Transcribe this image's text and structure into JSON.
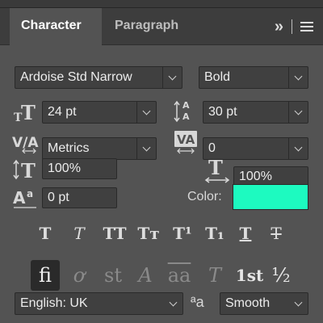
{
  "tabs": [
    {
      "label": "Character"
    },
    {
      "label": "Paragraph"
    }
  ],
  "header_actions": {
    "expand_glyph": "»",
    "menu_icon": "hamburger-menu-icon"
  },
  "font": {
    "family": "Ardoise Std Narrow",
    "style": "Bold"
  },
  "size": {
    "value": "24 pt"
  },
  "leading": {
    "value": "30 pt"
  },
  "kerning": {
    "value": "Metrics"
  },
  "tracking": {
    "value": "0"
  },
  "vertical_scale": {
    "value": "100%"
  },
  "horizontal_scale": {
    "value": "100%"
  },
  "baseline_shift": {
    "value": "0 pt"
  },
  "color": {
    "label": "Color:",
    "swatch": "#1dfac0"
  },
  "style_buttons": [
    {
      "glyph": "T",
      "icon": "faux-bold-icon"
    },
    {
      "glyph": "T",
      "icon": "faux-italic-icon"
    },
    {
      "glyph": "TT",
      "icon": "all-caps-icon"
    },
    {
      "glyph": "Tт",
      "icon": "small-caps-icon"
    },
    {
      "glyph": "T¹",
      "icon": "superscript-icon"
    },
    {
      "glyph": "T₁",
      "icon": "subscript-icon"
    },
    {
      "glyph": "T",
      "icon": "underline-icon"
    },
    {
      "glyph": "T",
      "icon": "strikethrough-icon"
    }
  ],
  "opentype_buttons": [
    {
      "glyph": "fi",
      "icon": "standard-ligatures-icon"
    },
    {
      "glyph": "ơ",
      "icon": "contextual-alternates-icon"
    },
    {
      "glyph": "st",
      "icon": "discretionary-ligatures-icon"
    },
    {
      "glyph": "A",
      "icon": "swash-icon"
    },
    {
      "glyph": "aa",
      "icon": "stylistic-alternates-icon"
    },
    {
      "glyph": "T",
      "icon": "titling-alternates-icon"
    },
    {
      "glyph": "1st",
      "icon": "ordinals-icon"
    },
    {
      "glyph": "½",
      "icon": "fractions-icon"
    }
  ],
  "language": {
    "value": "English: UK"
  },
  "antialias": {
    "glyph": "ªa",
    "value": "Smooth"
  }
}
